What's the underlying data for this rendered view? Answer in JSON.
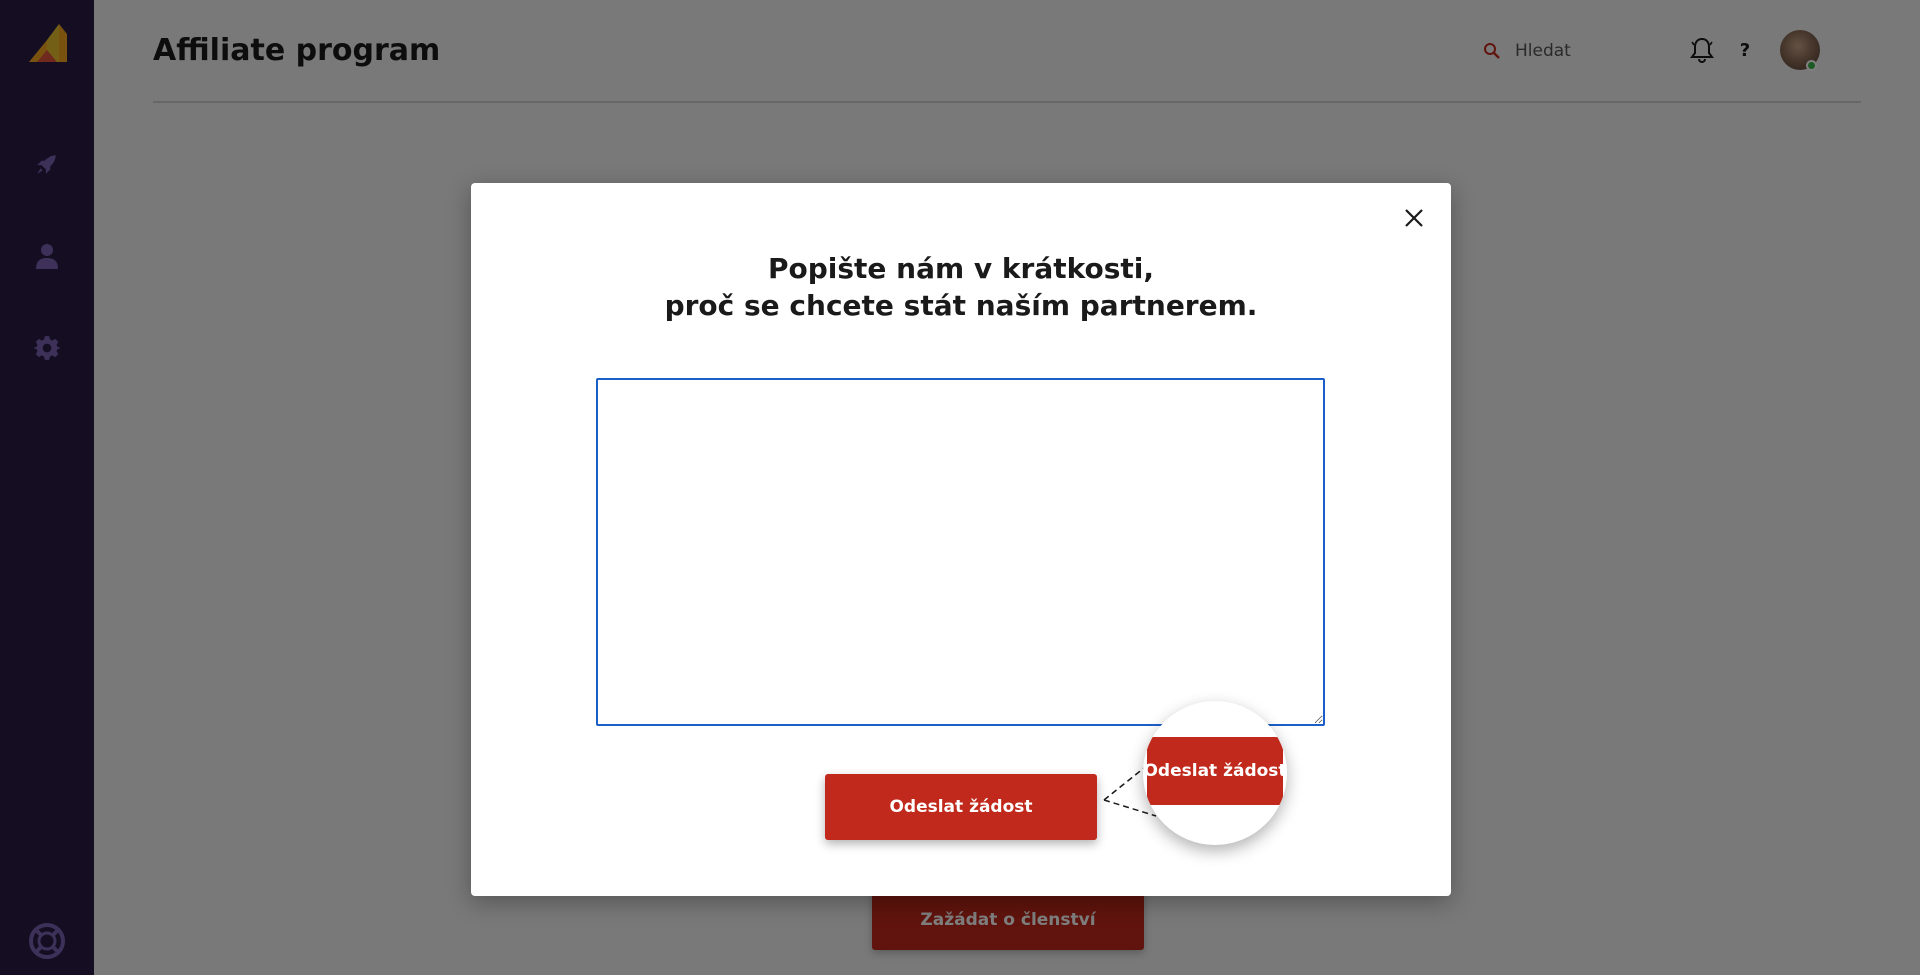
{
  "header": {
    "title": "Affiliate program",
    "search_placeholder": "Hledat",
    "help_label": "?"
  },
  "sidebar": {
    "items": [
      {
        "icon": "rocket-icon"
      },
      {
        "icon": "user-icon"
      },
      {
        "icon": "gear-icon"
      },
      {
        "icon": "lifebuoy-icon"
      }
    ]
  },
  "background": {
    "join_button_label": "Zažádat o členství"
  },
  "modal": {
    "title_line1": "Popište nám v krátkosti,",
    "title_line2": "proč se chcete stát naším partnerem.",
    "textarea_value": "",
    "submit_label": "Odeslat žádost",
    "zoom_label": "Odeslat žádost"
  },
  "colors": {
    "sidebar": "#2a1d47",
    "accent_red": "#c0291b",
    "focus_blue": "#1a5fc8",
    "online_green": "#3bb54a"
  }
}
